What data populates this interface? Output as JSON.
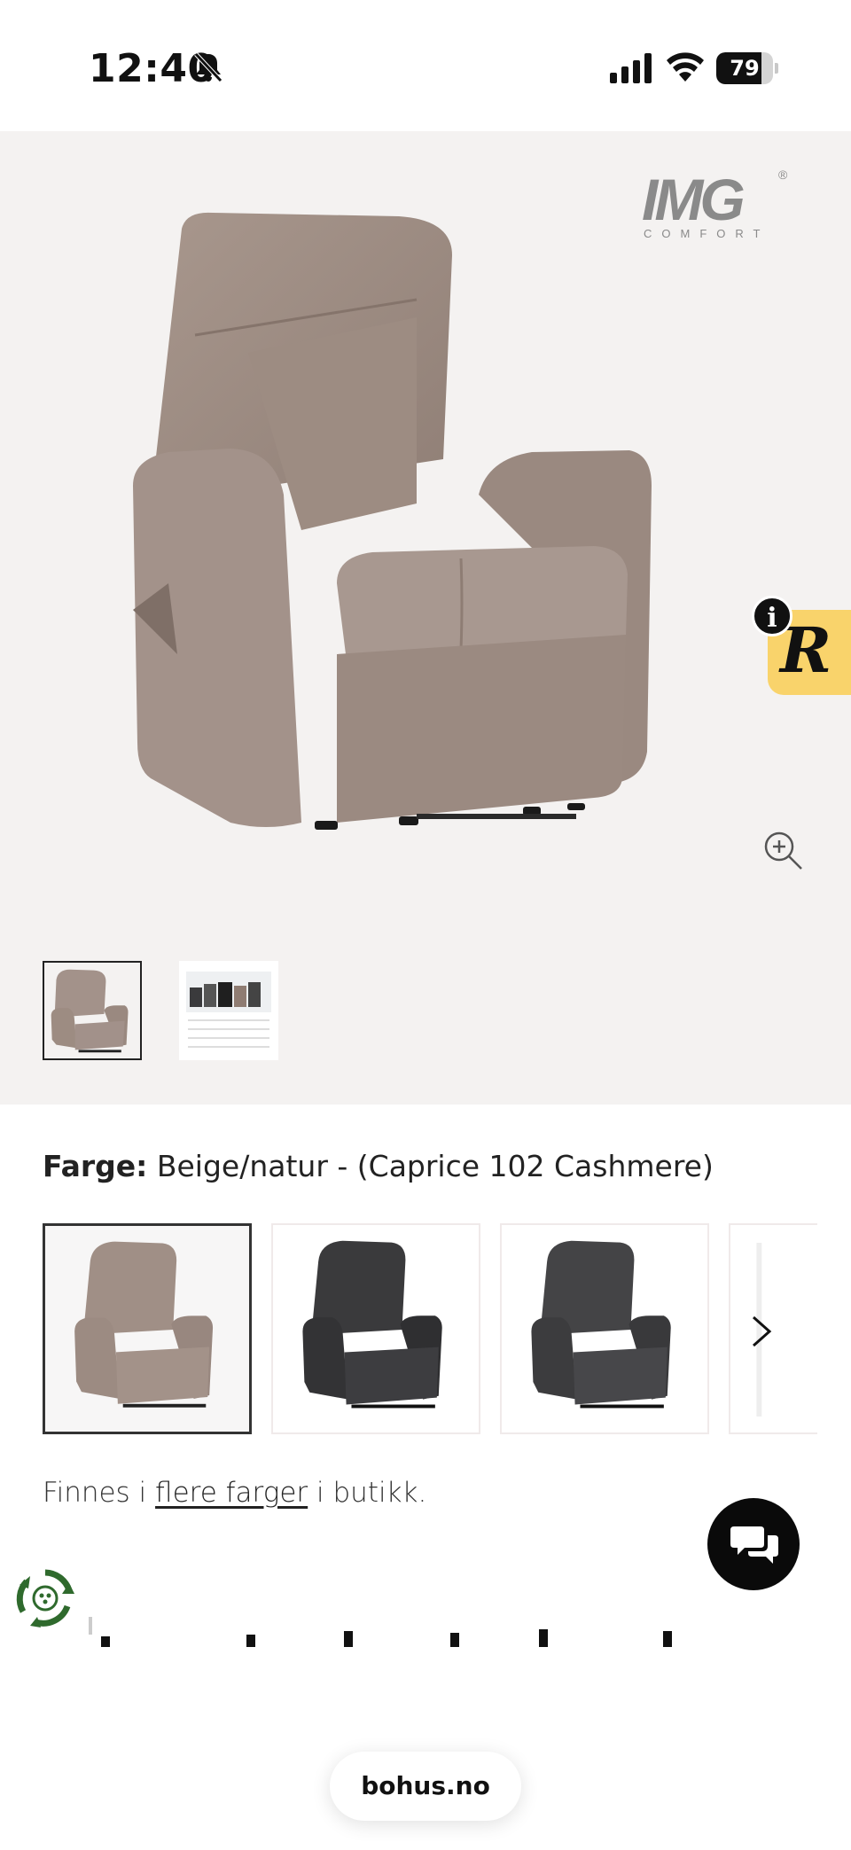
{
  "status_bar": {
    "time": "12:40",
    "battery_level": "79",
    "battery_fraction": 0.79,
    "icons": [
      "bell-slash-icon",
      "signal-icon",
      "wifi-icon",
      "battery-icon"
    ]
  },
  "gallery": {
    "brand": {
      "name": "IMG",
      "tagline": "COMFORT",
      "registered": "®"
    },
    "main_image_alt": "chair-image",
    "thumbnails": [
      "chair-thumbnail",
      "catalog-thumbnail"
    ],
    "icons": [
      "zoom-in-icon"
    ]
  },
  "review_badge": {
    "letter": "R",
    "info": "i"
  },
  "product": {
    "color_label": "Farge:",
    "color_value": "Beige/natur - (Caprice 102 Cashmere)",
    "color_swatches": [
      {
        "name": "beige",
        "color": "#a08f86"
      },
      {
        "name": "dark-grey-1",
        "color": "#3a3a3c"
      },
      {
        "name": "dark-grey-2",
        "color": "#444446"
      }
    ],
    "availability_prefix": "Finnes i",
    "availability_link": "flere farger",
    "availability_suffix": "i butikk."
  },
  "chat": {
    "icon": "chat-bubbles-icon"
  },
  "footer": {
    "url": "bohus.no"
  },
  "colors": {
    "gallery_bg": "#f4f2f1",
    "badge_yellow": "#f9d36b",
    "chair_beige": "#a08f86",
    "eco_green": "#2f6a2d"
  }
}
